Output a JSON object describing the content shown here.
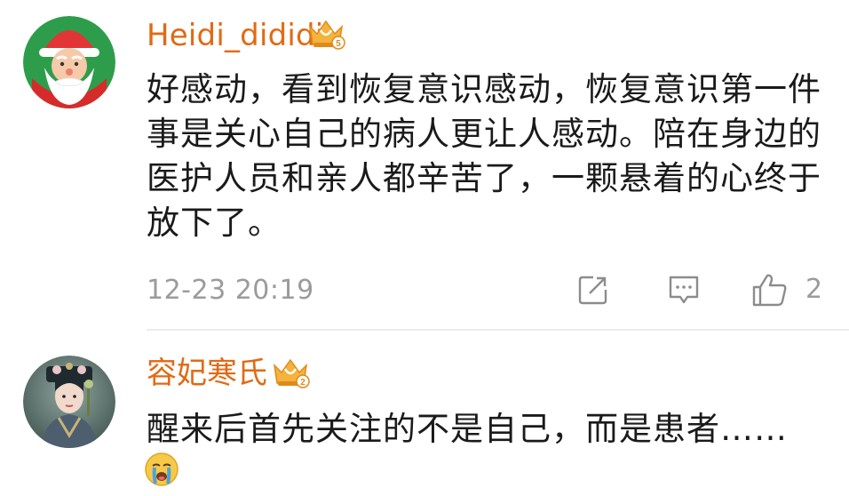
{
  "comments": [
    {
      "username": "Heidi_dididi",
      "vip_level": "5",
      "text": "好感动，看到恢复意识感动，恢复意识第一件事是关心自己的病人更让人感动。陪在身边的医护人员和亲人都辛苦了，一颗悬着的心终于放下了。",
      "timestamp": "12-23 20:19",
      "like_count": "2",
      "avatar_icon": "santa-claus-avatar",
      "colors": {
        "username": "#e06a14",
        "meta": "#9b9b9b"
      }
    },
    {
      "username": "容妃寒氏",
      "vip_level": "2",
      "text": "醒来后首先关注的不是自己，而是患者……",
      "emoji": "crying-emoji",
      "avatar_icon": "qing-dynasty-portrait-avatar"
    }
  ]
}
